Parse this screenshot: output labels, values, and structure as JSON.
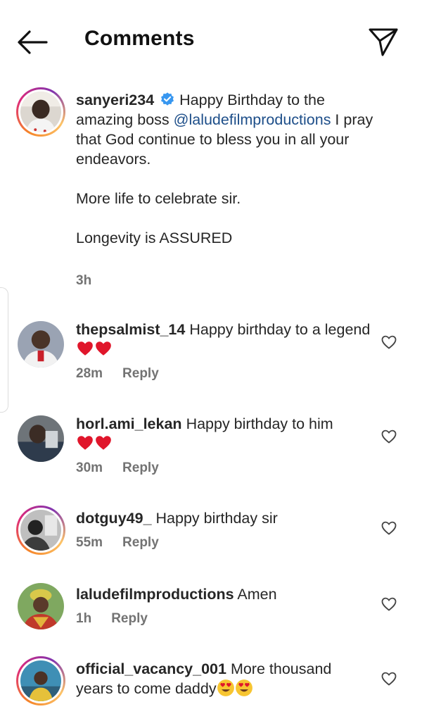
{
  "header": {
    "title": "Comments"
  },
  "caption": {
    "username": "sanyeri234",
    "text_a": "Happy Birthday to the amazing boss ",
    "mention": "@laludefilmproductions",
    "text_b": " I pray that God continue to bless you in all your endeavors.",
    "line2": "More life to celebrate sir.",
    "line3": "Longevity is ASSURED",
    "time": "3h"
  },
  "comments": [
    {
      "username": "thepsalmist_14",
      "text": "Happy birthday to a legend",
      "emoji": "heart-emoji x2",
      "time": "28m",
      "reply": "Reply"
    },
    {
      "username": "horl.ami_lekan",
      "text": "Happy birthday to him",
      "emoji": "heart-emoji x2",
      "time": "30m",
      "reply": "Reply"
    },
    {
      "username": "dotguy49_",
      "text": "Happy birthday sir",
      "time": "55m",
      "reply": "Reply"
    },
    {
      "username": "laludefilmproductions",
      "text": "Amen",
      "time": "1h",
      "reply": "Reply"
    },
    {
      "username": "official_vacancy_001",
      "text": "More thousand years to come daddy",
      "emoji": "heart-eyes-emoji x2"
    }
  ],
  "colors": {
    "verified": "#3897f0",
    "heart": "#e0162b",
    "mention": "#1d4e89"
  }
}
